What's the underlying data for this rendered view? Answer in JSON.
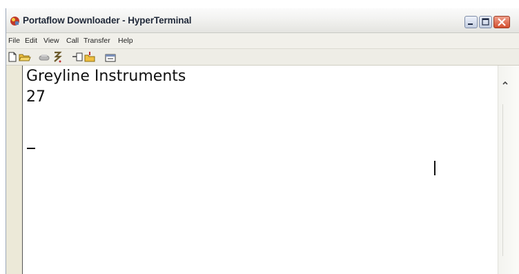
{
  "window": {
    "title": "Portaflow Downloader - HyperTerminal"
  },
  "menu": {
    "items": [
      "File",
      "Edit",
      "View",
      "Call",
      "Transfer",
      "Help"
    ]
  },
  "toolbar": {
    "icons": [
      "new-connection-icon",
      "open-icon",
      "disconnect-icon",
      "dial-icon",
      "send-icon",
      "receive-icon",
      "properties-icon"
    ]
  },
  "terminal": {
    "lines": [
      "Greyline Instruments",
      "27"
    ],
    "cursor_glyph": "_"
  },
  "colors": {
    "close_button": "#d3502f",
    "app_icon": "#c0392b",
    "terminal_bg": "#ffffff"
  }
}
